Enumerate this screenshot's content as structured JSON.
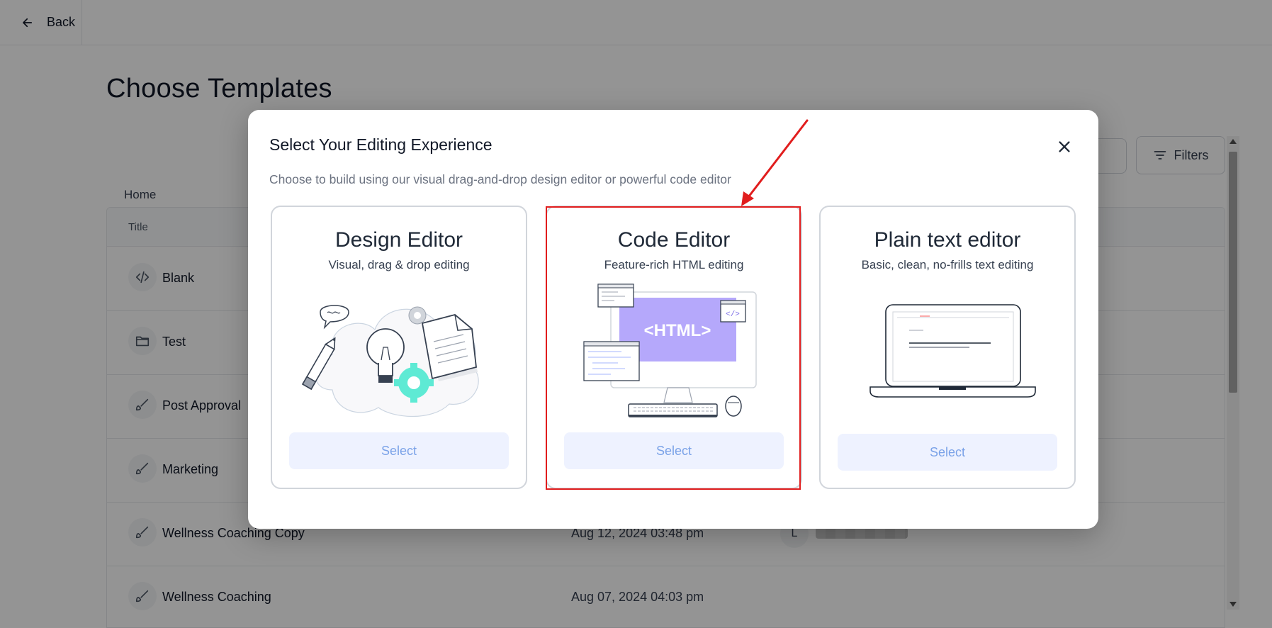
{
  "topbar": {
    "back_label": "Back"
  },
  "page": {
    "title": "Choose Templates",
    "filters_label": "Filters",
    "breadcrumb": "Home",
    "table_header_title": "Title"
  },
  "rows": [
    {
      "name": "Blank",
      "icon": "code-icon",
      "date": ""
    },
    {
      "name": "Test",
      "icon": "folder-icon",
      "date": ""
    },
    {
      "name": "Post Approval",
      "icon": "brush-icon",
      "date": ""
    },
    {
      "name": "Marketing",
      "icon": "brush-icon",
      "date": ""
    },
    {
      "name": "Wellness Coaching Copy",
      "icon": "brush-icon",
      "date": "Aug 12, 2024 03:48 pm",
      "avatar": "L"
    },
    {
      "name": "Wellness Coaching",
      "icon": "brush-icon",
      "date": "Aug 07, 2024 04:03 pm"
    }
  ],
  "modal": {
    "title": "Select Your Editing Experience",
    "subtitle": "Choose to build using our visual drag-and-drop design editor or powerful code editor",
    "cards": [
      {
        "title": "Design Editor",
        "subtitle": "Visual, drag & drop editing",
        "select_label": "Select"
      },
      {
        "title": "Code Editor",
        "subtitle": "Feature-rich HTML editing",
        "select_label": "Select",
        "illustration_text": "<HTML>"
      },
      {
        "title": "Plain text editor",
        "subtitle": "Basic, clean, no-frills text editing",
        "select_label": "Select"
      }
    ]
  },
  "colors": {
    "highlight": "#e11d1d",
    "select_text": "#7aa2e8",
    "select_bg": "#eef2ff",
    "html_screen": "#b5a8fb",
    "gear_accent": "#5eead4"
  }
}
